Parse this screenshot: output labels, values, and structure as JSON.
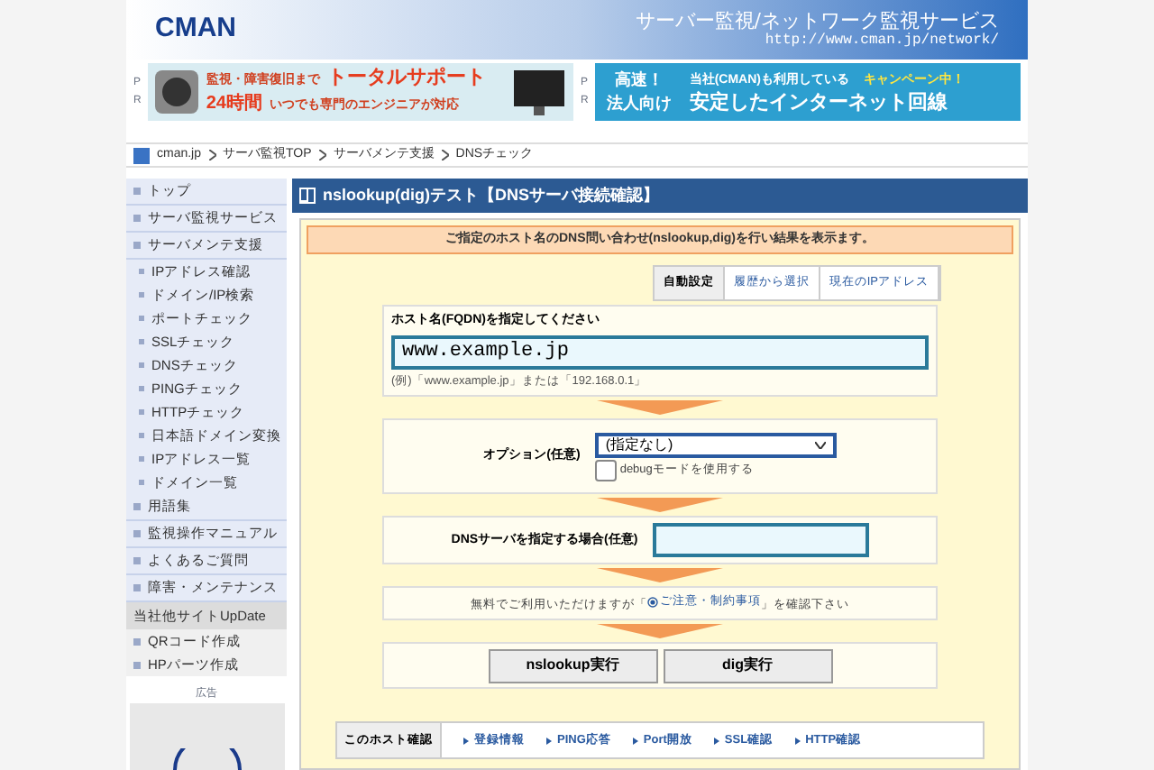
{
  "header": {
    "logo": "CMAN",
    "tagline": "サーバー監視/ネットワーク監視サービス",
    "url": "http://www.cman.jp/network/"
  },
  "ads": [
    {
      "pr": [
        "P",
        "R"
      ],
      "lines": [
        "監視・障害復旧まで",
        "トータルサポート",
        "24時間",
        "いつでも専門のエンジニアが対応"
      ]
    },
    {
      "pr": [
        "P",
        "R"
      ],
      "lines": [
        "高速！",
        "当社(CMAN)も利用している",
        "キャンペーン中！",
        "法人向け",
        "安定したインターネット回線"
      ]
    }
  ],
  "breadcrumb": [
    "cman.jp",
    "サーバ監視TOP",
    "サーバメンテ支援",
    "DNSチェック"
  ],
  "sidebar": {
    "items": [
      {
        "label": "トップ",
        "kind": "section"
      },
      {
        "label": "サーバ監視サービス",
        "kind": "section"
      },
      {
        "label": "サーバメンテ支援",
        "kind": "section",
        "children": [
          {
            "label": "IPアドレス確認"
          },
          {
            "label": "ドメイン/IP検索"
          },
          {
            "label": "ポートチェック"
          },
          {
            "label": "SSLチェック"
          },
          {
            "label": "DNSチェック"
          },
          {
            "label": "PINGチェック"
          },
          {
            "label": "HTTPチェック"
          },
          {
            "label": "日本語ドメイン変換"
          },
          {
            "label": "IPアドレス一覧"
          },
          {
            "label": "ドメイン一覧"
          }
        ]
      },
      {
        "label": "用語集",
        "kind": "section"
      },
      {
        "label": "監視操作マニュアル",
        "kind": "section"
      },
      {
        "label": "よくあるご質問",
        "kind": "section"
      },
      {
        "label": "障害・メンテナンス",
        "kind": "section"
      },
      {
        "label": "当社他サイトUpDate",
        "kind": "heading"
      },
      {
        "label": "QRコード作成",
        "kind": "other"
      },
      {
        "label": "HPパーツ作成",
        "kind": "other"
      }
    ],
    "ad_label": "広告"
  },
  "main": {
    "title": "nslookup(dig)テスト【DNSサーバ接続確認】",
    "notice": "ご指定のホスト名のDNS問い合わせ(nslookup,dig)を行い結果を表示ます。",
    "tabs": [
      {
        "label": "自動設定",
        "selected": true
      },
      {
        "label": "履歴から選択",
        "selected": false
      },
      {
        "label": "現在のIPアドレス",
        "selected": false
      }
    ],
    "host": {
      "label": "ホスト名(FQDN)を指定してください",
      "value": "www.example.jp",
      "hint": "(例)「www.example.jp」または「192.168.0.1」"
    },
    "option": {
      "label": "オプション(任意)",
      "select": "(指定なし)",
      "debug_label": "debugモードを使用する",
      "debug_checked": false
    },
    "dns": {
      "label": "DNSサーバを指定する場合(任意)"
    },
    "terms": {
      "before": "無料でご利用いただけますが「",
      "link": "ご注意・制約事項",
      "after": "」を確認下さい"
    },
    "buttons": [
      "nslookup実行",
      "dig実行"
    ],
    "host_links": {
      "label": "このホスト確認",
      "links": [
        "登録情報",
        "PING応答",
        "Port開放",
        "SSL確認",
        "HTTP確認"
      ]
    }
  }
}
